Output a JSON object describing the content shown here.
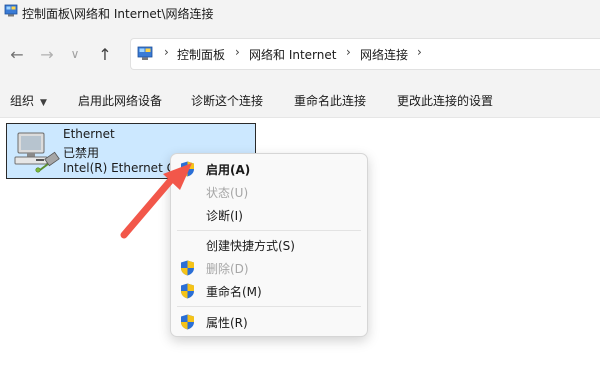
{
  "window": {
    "title": "控制面板\\网络和 Internet\\网络连接"
  },
  "nav": {
    "back": "←",
    "forward": "→",
    "recent": "∨",
    "up": "↑"
  },
  "address": {
    "crumbs": [
      "控制面板",
      "网络和 Internet",
      "网络连接"
    ],
    "sep": "›"
  },
  "toolbar": {
    "organize": "组织",
    "organize_caret": "▼",
    "enable_device": "启用此网络设备",
    "diagnose": "诊断这个连接",
    "rename": "重命名此连接",
    "change_settings": "更改此连接的设置"
  },
  "adapter": {
    "name": "Ethernet",
    "status": "已禁用",
    "device": "Intel(R) Ethernet C"
  },
  "context_menu": {
    "enable": "启用(A)",
    "status": "状态(U)",
    "diagnose": "诊断(I)",
    "create_shortcut": "创建快捷方式(S)",
    "delete": "删除(D)",
    "rename": "重命名(M)",
    "properties": "属性(R)"
  },
  "colors": {
    "selection": "#cce8ff",
    "arrow": "#f2574a",
    "shield_blue": "#2b6fd6",
    "shield_yellow": "#f5c318"
  },
  "icons": [
    "control-panel-icon",
    "network-adapter-icon",
    "uac-shield-icon",
    "red-pointer-arrow"
  ]
}
